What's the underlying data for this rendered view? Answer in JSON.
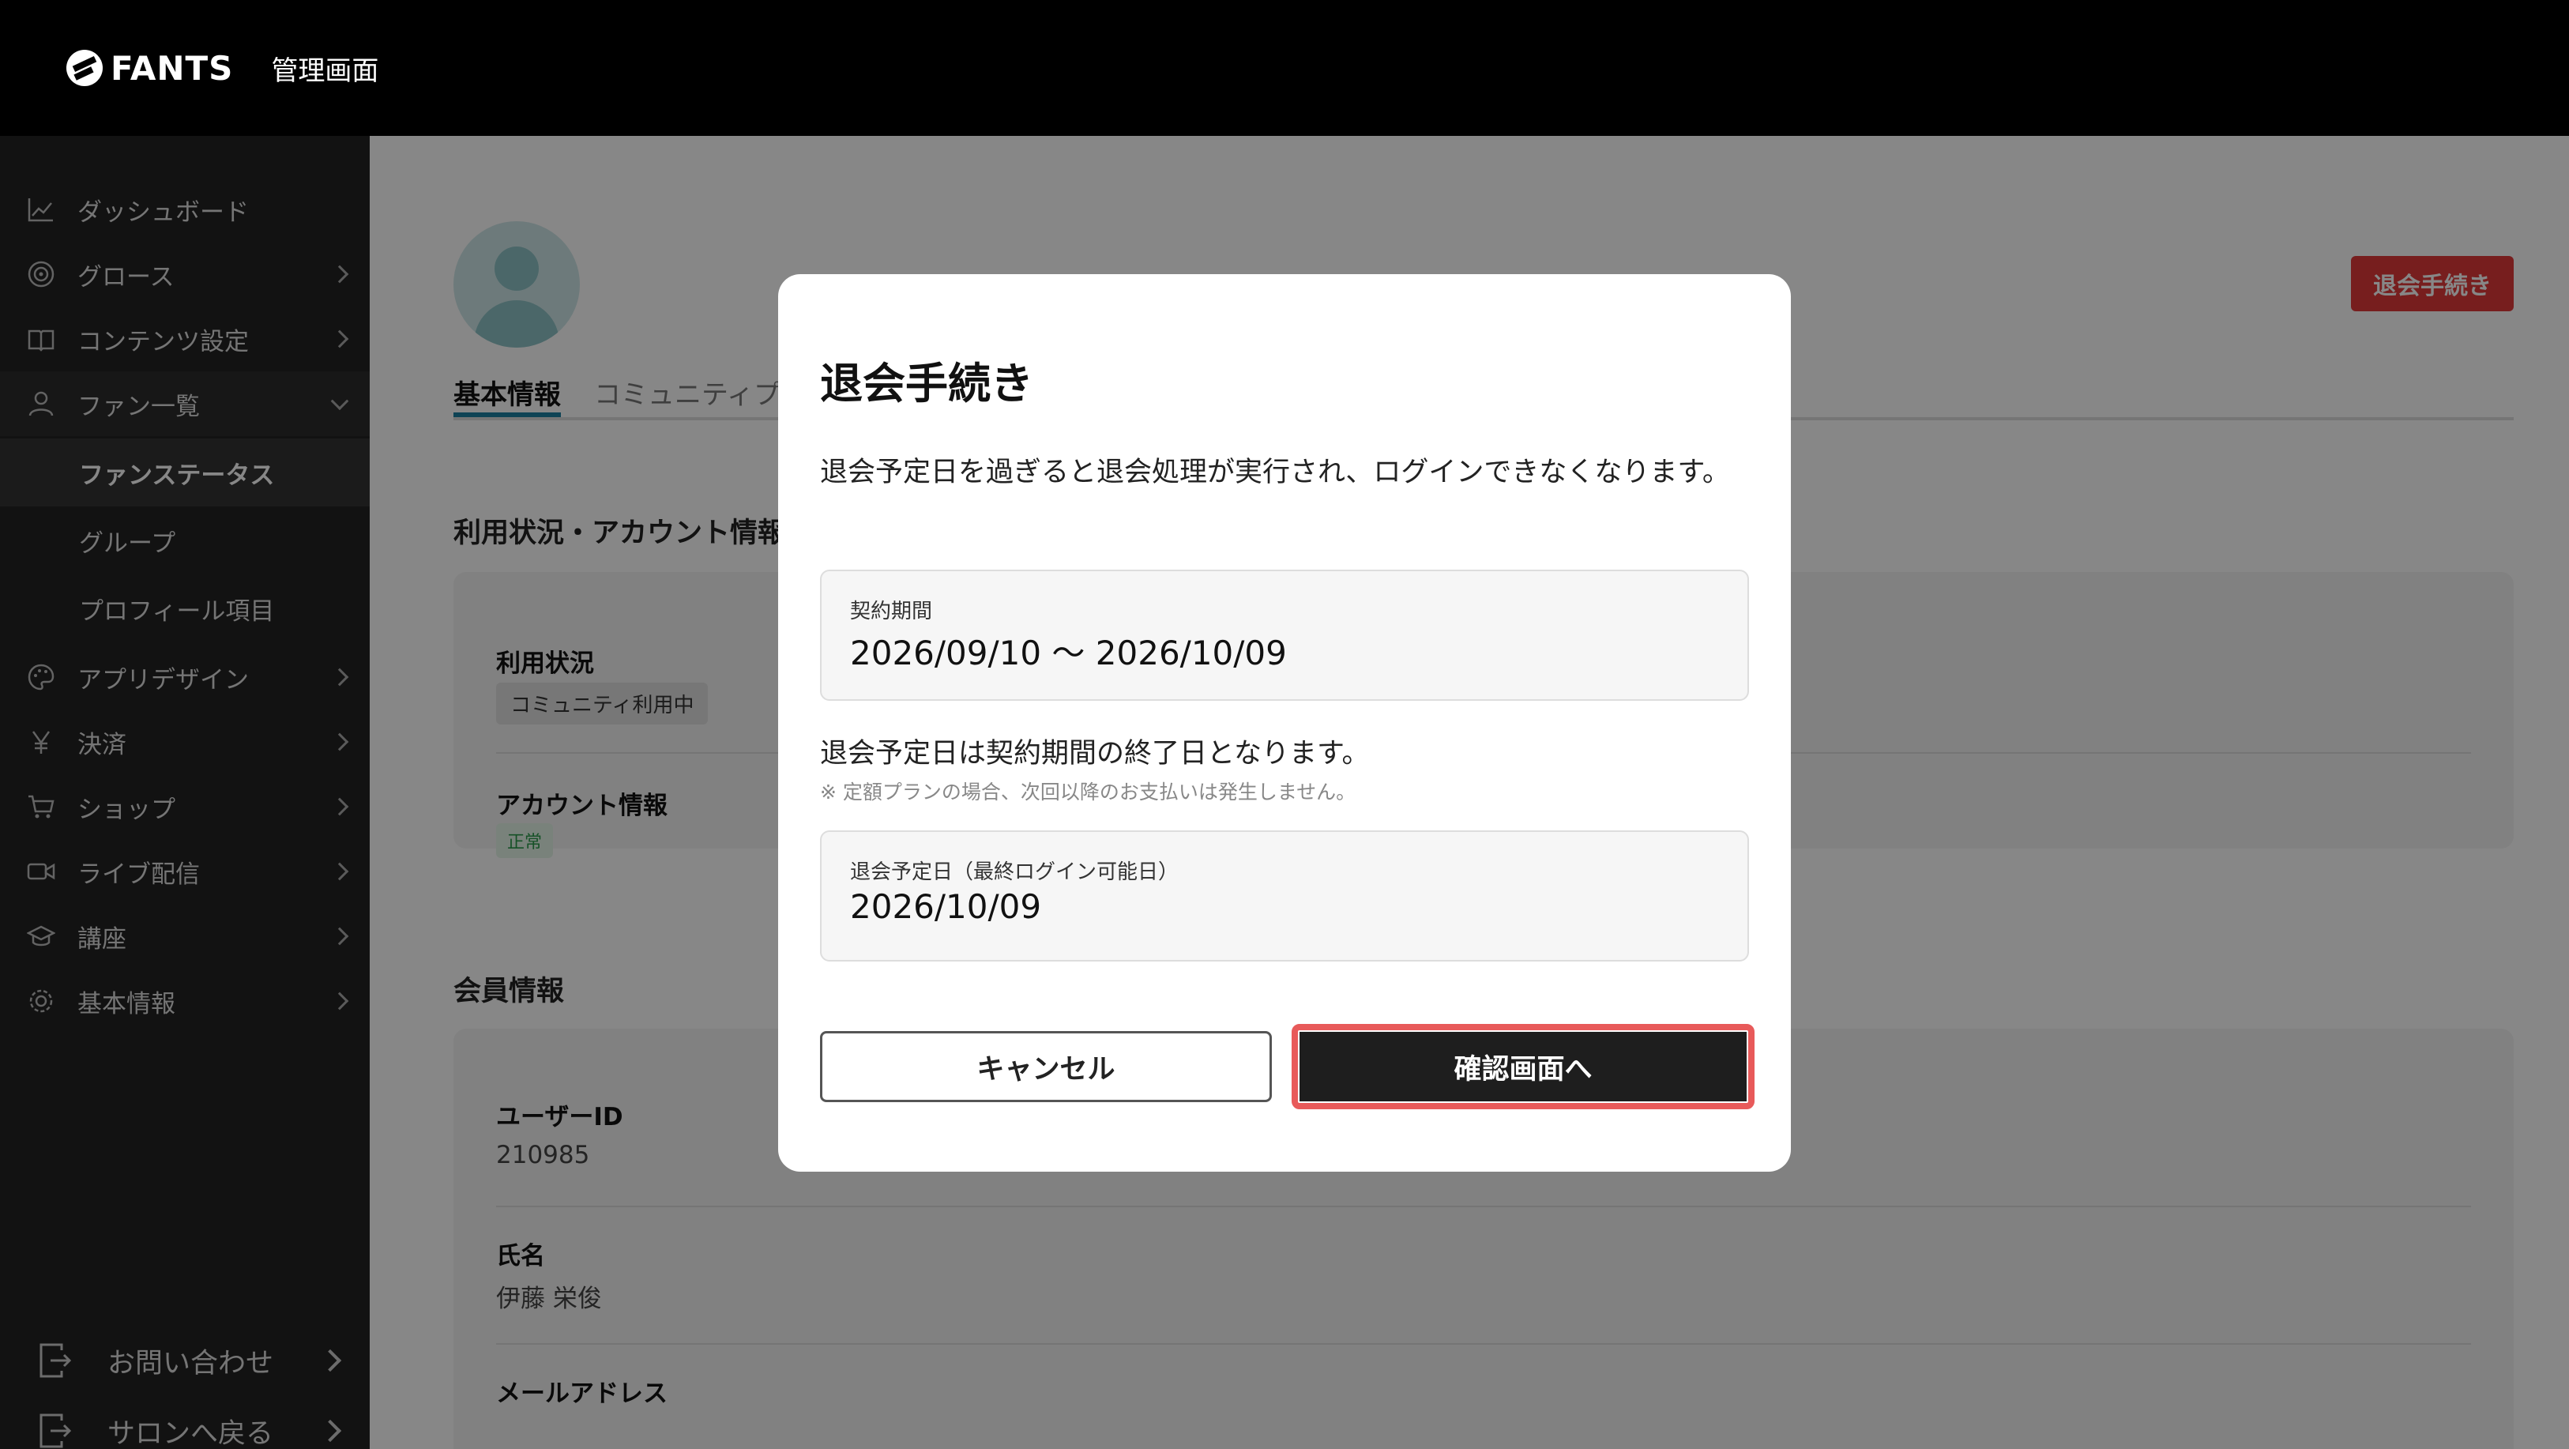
{
  "header": {
    "logo_text": "FANTS",
    "admin_title": "管理画面"
  },
  "sidebar": {
    "items": [
      {
        "label": "ダッシュボード",
        "icon": "chart-icon"
      },
      {
        "label": "グロース",
        "icon": "target-icon"
      },
      {
        "label": "コンテンツ設定",
        "icon": "book-icon"
      },
      {
        "label": "ファン一覧",
        "icon": "person-icon"
      },
      {
        "label": "アプリデザイン",
        "icon": "palette-icon"
      },
      {
        "label": "決済",
        "icon": "yen-icon"
      },
      {
        "label": "ショップ",
        "icon": "cart-icon"
      },
      {
        "label": "ライブ配信",
        "icon": "video-icon"
      },
      {
        "label": "講座",
        "icon": "graduation-cap-icon"
      },
      {
        "label": "基本情報",
        "icon": "gear-icon"
      }
    ],
    "sub_items": [
      "ファンステータス",
      "グループ",
      "プロフィール項目"
    ],
    "footer": [
      "お問い合わせ",
      "サロンへ戻る"
    ]
  },
  "main": {
    "withdraw_button": "退会手続き",
    "tabs": [
      "基本情報",
      "コミュニティプ"
    ],
    "section_usage": "利用状況・アカウント情報",
    "usage_label": "利用状況",
    "usage_chip": "コミュニティ利用中",
    "account_label": "アカウント情報",
    "account_chip": "正常",
    "section_member": "会員情報",
    "user_id_label": "ユーザーID",
    "user_id": "210985",
    "name_label": "氏名",
    "name": "伊藤 栄俊",
    "email_label": "メールアドレス"
  },
  "modal": {
    "title": "退会手続き",
    "description": "退会予定日を過ぎると退会処理が実行され、ログインできなくなります。",
    "contract_label": "契約期間",
    "contract_value": "2026/09/10 ～ 2026/10/09",
    "note_main": "退会予定日は契約期間の終了日となります。",
    "note_sub": "※ 定額プランの場合、次回以降のお支払いは発生しません。",
    "withdraw_date_label": "退会予定日（最終ログイン可能日）",
    "withdraw_date_value": "2026/10/09",
    "cancel_label": "キャンセル",
    "confirm_label": "確認画面へ"
  },
  "colors": {
    "accent_red": "#e03a3a",
    "tab_active": "#1c7fa0",
    "highlight_outline": "#e85a5a"
  }
}
